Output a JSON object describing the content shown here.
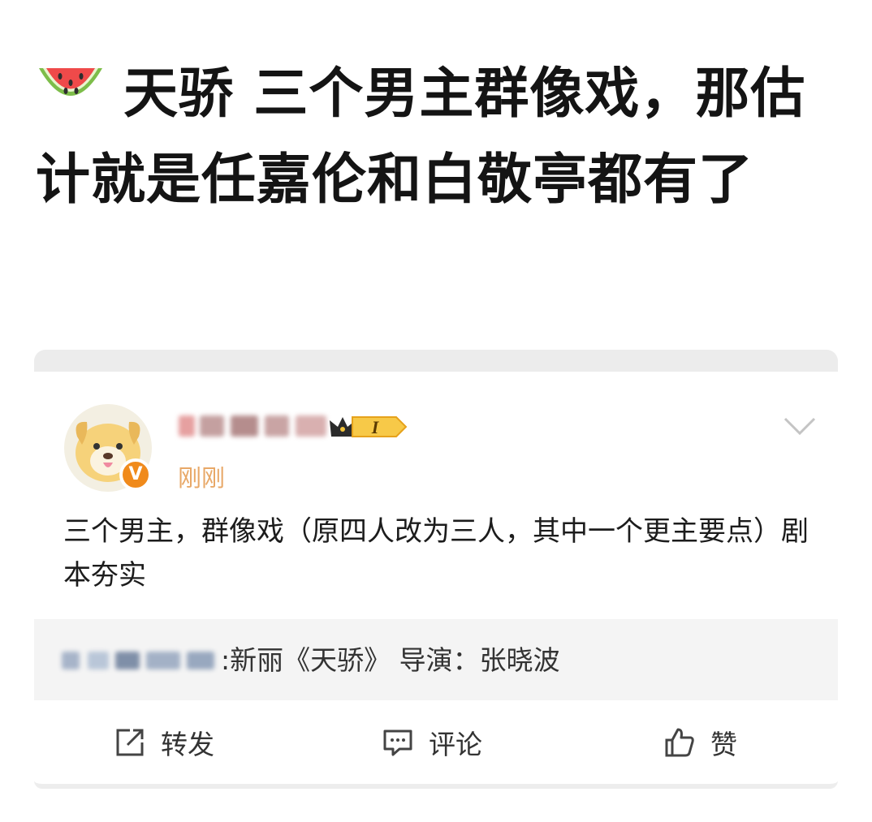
{
  "headline": {
    "emoji_icon": "watermelon-icon",
    "text": "天骄 三个男主群像戏，那估计就是任嘉伦和白敬亭都有了"
  },
  "post": {
    "avatar_icon": "cartoon-dog-avatar",
    "verified_badge": "V",
    "level_badge": "I",
    "timestamp": "刚刚",
    "body": "三个男主，群像戏（原四人改为三人，其中一个更主要点）剧本夯实",
    "topic": {
      "text": ":新丽《天骄》 导演：张晓波"
    },
    "actions": {
      "repost": "转发",
      "comment": "评论",
      "like": "赞"
    }
  },
  "colors": {
    "timestamp": "#e8a867",
    "verified": "#f08a1b",
    "topic_bg": "#f4f4f4"
  }
}
